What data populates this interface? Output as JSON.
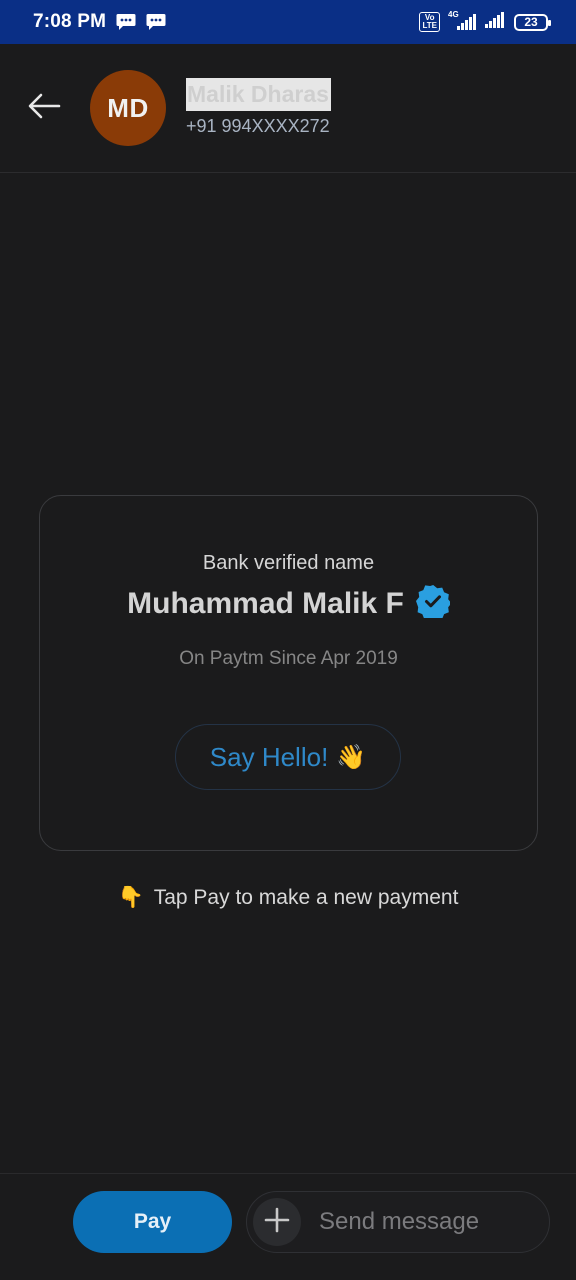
{
  "status_bar": {
    "time": "7:08 PM",
    "icons": [
      "message-icon",
      "message-icon",
      "volte-icon",
      "4g-signal-icon",
      "signal-icon"
    ],
    "volte_label": "Vo\nLTE",
    "network_label": "4G",
    "battery": "23"
  },
  "header": {
    "back_icon": "arrow-left-icon",
    "avatar_initials": "MD",
    "contact_name": "Malik Dharas",
    "contact_phone": "+91 994XXXX272"
  },
  "card": {
    "label": "Bank verified name",
    "verified_name": "Muhammad Malik F",
    "verified_icon": "verified-badge-icon",
    "since": "On Paytm Since Apr 2019",
    "say_hello": "Say Hello!",
    "say_hello_emoji": "👋"
  },
  "hint": {
    "emoji": "👇",
    "text": "Tap Pay to make a new payment"
  },
  "bottom_bar": {
    "pay_label": "Pay",
    "message_placeholder": "Send message",
    "plus_icon": "plus-icon"
  },
  "colors": {
    "status_bar_bg": "#0a2f86",
    "background": "#1b1b1c",
    "avatar_bg": "#8a3b07",
    "accent": "#0b6fb4",
    "verified_badge": "#2a9fe0"
  }
}
